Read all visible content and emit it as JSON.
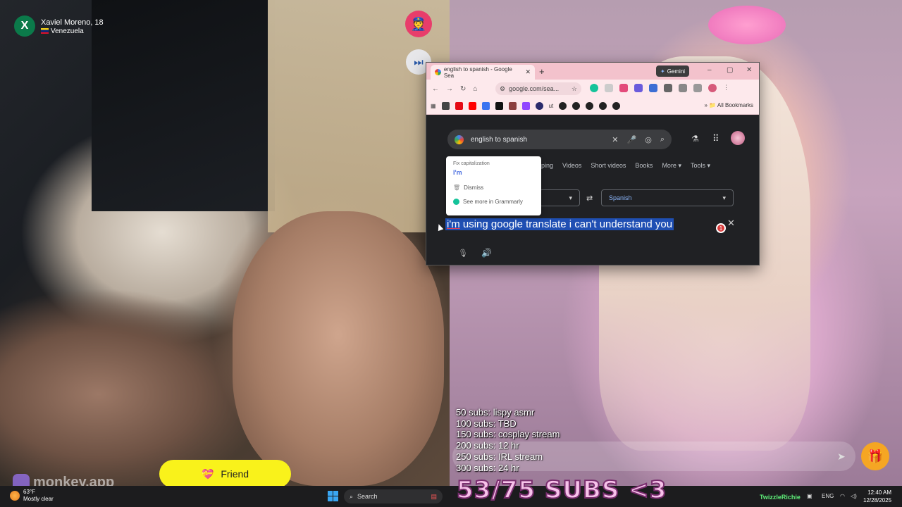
{
  "peer": {
    "avatar_letter": "X",
    "name_age": "Xaviel Moreno, 18",
    "country": "Venezuela"
  },
  "browser": {
    "tab_title": "english to spanish - Google Sea",
    "tab_close": "✕",
    "new_tab": "+",
    "gemini_label": "Gemini",
    "url": "google.com/sea...",
    "all_bookmarks": "All Bookmarks",
    "bookmark_text": "ut",
    "search_query": "english to spanish",
    "filters": [
      "pping",
      "Videos",
      "Short videos",
      "Books",
      "More ▾",
      "Tools ▾"
    ],
    "target_language": "Spanish",
    "input_text_rest": " using google translate i can't understand you",
    "input_text_im": "i'm",
    "badge_count": "1"
  },
  "grammarly": {
    "header": "Fix capitalization",
    "suggestion": "I'm",
    "dismiss": "Dismiss",
    "see_more": "See more in Grammarly"
  },
  "sub_goals": [
    "50 subs: lispy asmr",
    "100 subs: TBD",
    "150 subs: cosplay stream",
    "200 subs: 12 hr",
    "250 subs: IRL stream",
    "300 subs: 24 hr"
  ],
  "friend_button": "Friend",
  "watermark": "monkey.app",
  "sub_counter": "53/75 SUBS <3",
  "taskbar": {
    "weather_temp": "63°F",
    "weather_desc": "Mostly clear",
    "search": "Search",
    "tray_app": "TwizzleRichie",
    "lang": "ENG",
    "time": "12:40 AM",
    "date": "12/28/2025"
  },
  "icons": {
    "report": "police-officer-icon",
    "skip": "skip-forward-icon",
    "gift": "gift-icon",
    "send": "send-icon"
  }
}
